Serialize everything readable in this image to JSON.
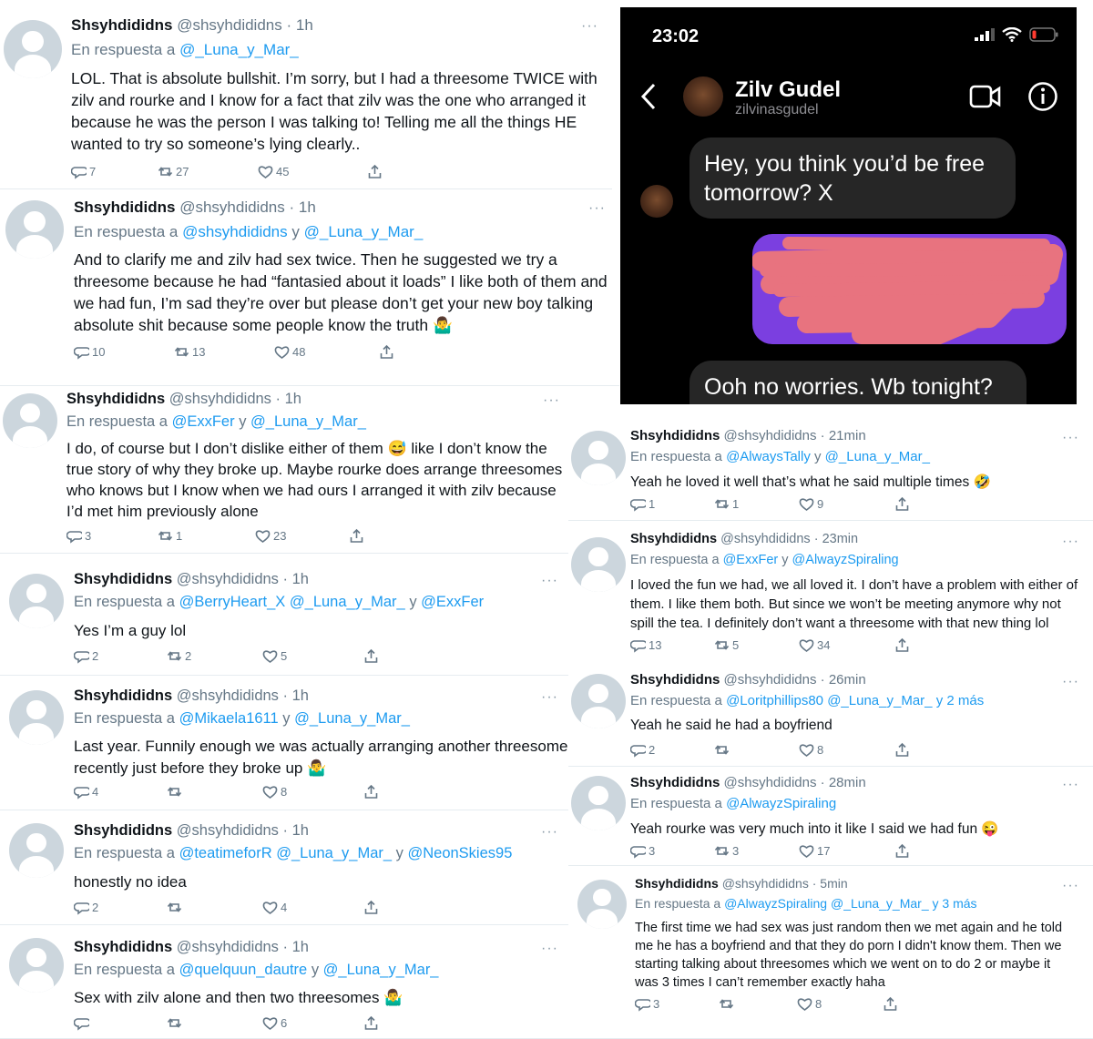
{
  "phone": {
    "time": "23:02",
    "contact_name": "Zilv Gudel",
    "contact_username": "zilvinasgudel",
    "msg_incoming_1": "Hey, you think you’d be free tomorrow? X",
    "msg_incoming_2": "Ooh no worries. Wb tonight?",
    "icons": [
      "signal-icon",
      "wifi-icon",
      "battery-low-icon",
      "back-chevron-icon",
      "video-call-icon",
      "info-icon"
    ],
    "colors": {
      "background": "#000000",
      "incoming_bubble": "#262626",
      "outgoing_bubble": "#7b3fe0",
      "redaction": "#e8737f",
      "battery_low": "#ff3b30"
    }
  },
  "labels": {
    "reply_prefix": "En respuesta a",
    "and": "y",
    "more_menu": "···"
  },
  "tweets": [
    {
      "name": "Shsyhdididns",
      "handle": "@shsyhdididns",
      "time": "1h",
      "reply_to": [
        "@_Luna_y_Mar_"
      ],
      "text": "LOL. That is absolute bullshit. I’m sorry, but I had a threesome TWICE with zilv and rourke and I know for a fact that zilv was the one who arranged it because he was the person I was talking to! Telling me all the things HE wanted to try so someone’s lying clearly..",
      "replies": "7",
      "retweets": "27",
      "likes": "45"
    },
    {
      "name": "Shsyhdididns",
      "handle": "@shsyhdididns",
      "time": "1h",
      "reply_to": [
        "@shsyhdididns",
        "@_Luna_y_Mar_"
      ],
      "text": "And to clarify me and zilv had sex twice. Then he suggested we try a threesome because he had “fantasied about it loads” I like both of them and we had fun, I’m sad they’re over but please don’t get your new boy talking absolute shit because some people know the truth 🤷‍♂️",
      "replies": "10",
      "retweets": "13",
      "likes": "48"
    },
    {
      "name": "Shsyhdididns",
      "handle": "@shsyhdididns",
      "time": "1h",
      "reply_to": [
        "@ExxFer",
        "@_Luna_y_Mar_"
      ],
      "text": "I do, of course but I don’t dislike either of them 😅 like I don’t know the true story of why they broke up. Maybe rourke does arrange threesomes who knows but I know when we had ours I arranged it with zilv because I’d met him previously alone",
      "replies": "3",
      "retweets": "1",
      "likes": "23"
    },
    {
      "name": "Shsyhdididns",
      "handle": "@shsyhdididns",
      "time": "1h",
      "reply_to": [
        "@BerryHeart_X",
        "@_Luna_y_Mar_",
        "@ExxFer"
      ],
      "text": "Yes I’m a guy lol",
      "replies": "2",
      "retweets": "2",
      "likes": "5"
    },
    {
      "name": "Shsyhdididns",
      "handle": "@shsyhdididns",
      "time": "1h",
      "reply_to": [
        "@Mikaela1611",
        "@_Luna_y_Mar_"
      ],
      "text": "Last year. Funnily enough we was actually arranging another threesome recently just before they broke up 🤷‍♂️",
      "replies": "4",
      "retweets": "",
      "likes": "8"
    },
    {
      "name": "Shsyhdididns",
      "handle": "@shsyhdididns",
      "time": "1h",
      "reply_to": [
        "@teatimeforR",
        "@_Luna_y_Mar_",
        "@NeonSkies95"
      ],
      "text": "honestly no idea",
      "replies": "2",
      "retweets": "",
      "likes": "4"
    },
    {
      "name": "Shsyhdididns",
      "handle": "@shsyhdididns",
      "time": "1h",
      "reply_to": [
        "@quelquun_dautre",
        "@_Luna_y_Mar_"
      ],
      "text": "Sex with zilv alone and  then two threesomes 🤷‍♂️",
      "replies": "",
      "retweets": "",
      "likes": "6"
    },
    {
      "name": "Shsyhdididns",
      "handle": "@shsyhdididns",
      "time": "21min",
      "reply_to": [
        "@AlwaysTally",
        "@_Luna_y_Mar_"
      ],
      "text": "Yeah he loved it well that’s what he said multiple times 🤣",
      "replies": "1",
      "retweets": "1",
      "likes": "9"
    },
    {
      "name": "Shsyhdididns",
      "handle": "@shsyhdididns",
      "time": "23min",
      "reply_to": [
        "@ExxFer",
        "@AlwayzSpiraling"
      ],
      "text": "I loved the fun we had, we all loved it. I don’t have a problem with either of them. I like them both. But since we won’t be meeting anymore why not spill the tea. I definitely don’t want a threesome with that new thing lol",
      "replies": "13",
      "retweets": "5",
      "likes": "34"
    },
    {
      "name": "Shsyhdididns",
      "handle": "@shsyhdididns",
      "time": "26min",
      "reply_to": [
        "@Loritphillips80",
        "@_Luna_y_Mar_"
      ],
      "reply_more": "y 2 más",
      "text": "Yeah he said he had a boyfriend",
      "replies": "2",
      "retweets": "",
      "likes": "8"
    },
    {
      "name": "Shsyhdididns",
      "handle": "@shsyhdididns",
      "time": "28min",
      "reply_to": [
        "@AlwayzSpiraling"
      ],
      "text": "Yeah rourke was very much into it like I said we had fun 😜",
      "replies": "3",
      "retweets": "3",
      "likes": "17"
    },
    {
      "name": "Shsyhdididns",
      "handle": "@shsyhdididns",
      "time": "5min",
      "reply_to": [
        "@AlwayzSpiraling",
        "@_Luna_y_Mar_"
      ],
      "reply_more": "y 3 más",
      "text": "The first time we had sex was just random then we met again and he told me he has a boyfriend and that they do porn I didn't know them. Then we starting talking about threesomes which we went on to do 2 or maybe it was 3 times I can’t remember exactly haha",
      "replies": "3",
      "retweets": "",
      "likes": "8"
    }
  ]
}
